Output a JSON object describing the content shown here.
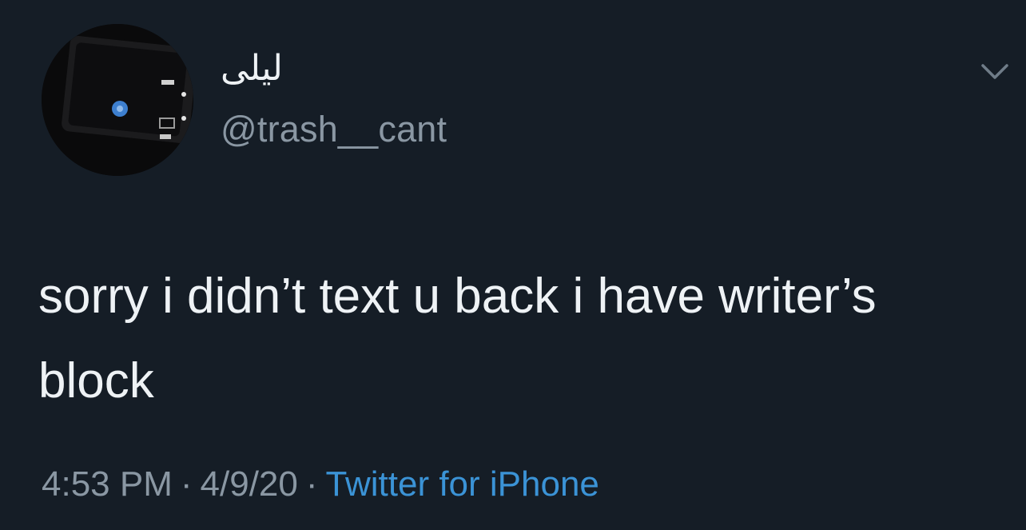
{
  "tweet": {
    "display_name": "ليلى",
    "handle": "@trash__cant",
    "text": "sorry i didn’t text u back i have writer’s block",
    "time": "4:53 PM",
    "date": "4/9/20",
    "separator": "·",
    "source": "Twitter for iPhone"
  },
  "icons": {
    "menu": "chevron-down-icon",
    "avatar": "profile-avatar"
  },
  "colors": {
    "background": "#151d26",
    "primary_text": "#eef2f5",
    "secondary_text": "#8a97a3",
    "link": "#3b93d6"
  }
}
